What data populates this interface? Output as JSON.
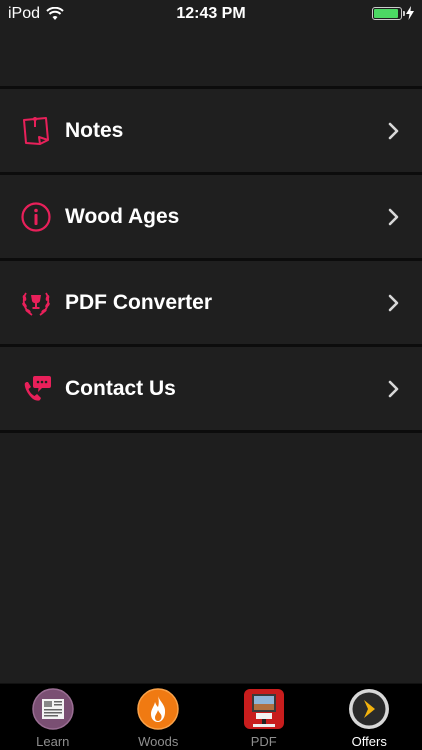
{
  "status_bar": {
    "carrier": "iPod",
    "time": "12:43 PM",
    "battery_color": "#4cd964"
  },
  "accent_color": "#e8205a",
  "menu": {
    "items": [
      {
        "label": "Notes",
        "icon": "notes-icon"
      },
      {
        "label": "Wood Ages",
        "icon": "info-icon"
      },
      {
        "label": "PDF Converter",
        "icon": "laurel-trophy-icon"
      },
      {
        "label": "Contact Us",
        "icon": "phone-chat-icon"
      }
    ]
  },
  "tab_bar": {
    "tabs": [
      {
        "label": "Learn",
        "icon": "newspaper-icon",
        "active": false
      },
      {
        "label": "Woods",
        "icon": "flame-icon",
        "active": false
      },
      {
        "label": "PDF",
        "icon": "pdf-document-icon",
        "active": false
      },
      {
        "label": "Offers",
        "icon": "chevron-circle-icon",
        "active": true
      }
    ]
  }
}
